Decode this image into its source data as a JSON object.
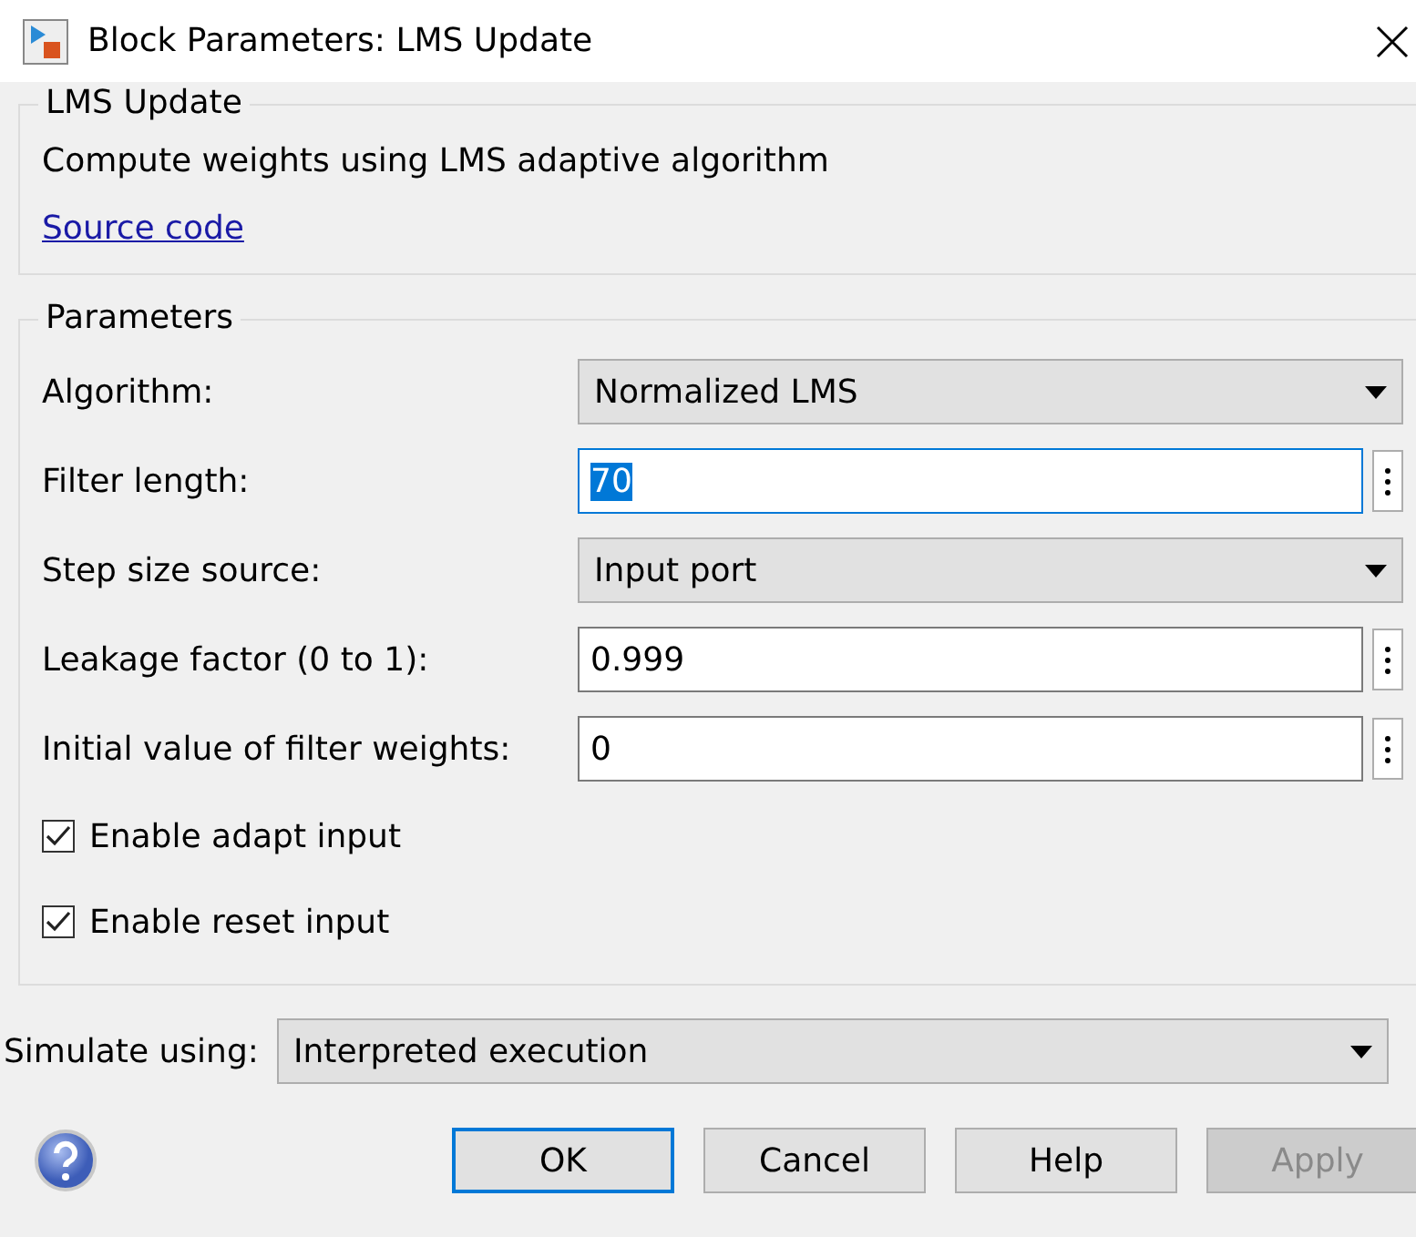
{
  "window": {
    "title": "Block Parameters: LMS Update"
  },
  "description_group": {
    "title": "LMS Update",
    "text": "Compute weights using LMS adaptive algorithm",
    "link": "Source code"
  },
  "parameters": {
    "title": "Parameters",
    "fields": [
      {
        "kind": "dropdown",
        "label": "Algorithm:",
        "value": "Normalized LMS"
      },
      {
        "kind": "edit",
        "label": "Filter length:",
        "value": "70",
        "focused": true
      },
      {
        "kind": "dropdown",
        "label": "Step size source:",
        "value": "Input port"
      },
      {
        "kind": "edit",
        "label": "Leakage factor (0 to 1):",
        "value": "0.999",
        "focused": false
      },
      {
        "kind": "edit",
        "label": "Initial value of filter weights:",
        "value": "0",
        "focused": false
      }
    ],
    "checkboxes": [
      {
        "label": "Enable adapt input",
        "checked": true
      },
      {
        "label": "Enable reset input",
        "checked": true
      }
    ]
  },
  "simulate": {
    "label": "Simulate using:",
    "value": "Interpreted execution"
  },
  "buttons": [
    {
      "label": "OK",
      "default": true,
      "disabled": false
    },
    {
      "label": "Cancel",
      "default": false,
      "disabled": false
    },
    {
      "label": "Help",
      "default": false,
      "disabled": false
    },
    {
      "label": "Apply",
      "default": false,
      "disabled": true
    }
  ]
}
